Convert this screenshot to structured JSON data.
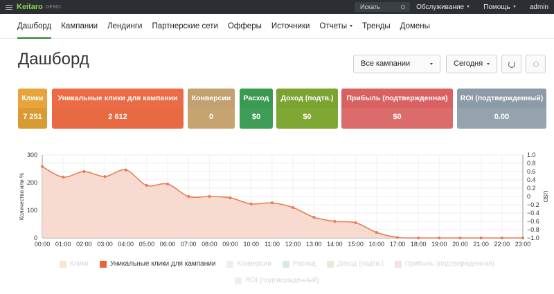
{
  "topbar": {
    "brand": "Keitaro",
    "demo": "DEMO",
    "search_label": "Искать",
    "service_menu": "Обслуживание",
    "help_menu": "Помощь",
    "user": "admin"
  },
  "nav": {
    "items": [
      "Дашборд",
      "Кампании",
      "Лендинги",
      "Партнерские сети",
      "Офферы",
      "Источники",
      "Отчеты",
      "Тренды",
      "Домены"
    ]
  },
  "page": {
    "title": "Дашборд",
    "campaign_select": "Все кампании",
    "period_select": "Сегодня"
  },
  "cards": [
    {
      "label": "Клики",
      "value": "7 251",
      "color": "#e8a33a",
      "value_color": "#d99a33"
    },
    {
      "label": "Уникальные клики для кампании",
      "value": "2 612",
      "color": "#ea6b45",
      "value_color": "#e86a43"
    },
    {
      "label": "Конверсии",
      "value": "0",
      "color": "#c2a070",
      "value_color": "#c6a472"
    },
    {
      "label": "Расход",
      "value": "$0",
      "color": "#3a9a52",
      "value_color": "#3e9d56"
    },
    {
      "label": "Доход (подтв.)",
      "value": "$0",
      "color": "#7aa32f",
      "value_color": "#7fa733"
    },
    {
      "label": "Прибыль (подтвержденная)",
      "value": "$0",
      "color": "#d96161",
      "value_color": "#dc6b6b"
    },
    {
      "label": "ROI (подтвержденный)",
      "value": "0.00",
      "color": "#8d9aa7",
      "value_color": "#96a2ae"
    }
  ],
  "chart_data": {
    "type": "area",
    "x": [
      "00:00",
      "01:00",
      "02:00",
      "03:00",
      "04:00",
      "05:00",
      "06:00",
      "07:00",
      "08:00",
      "09:00",
      "10:00",
      "11:00",
      "12:00",
      "13:00",
      "14:00",
      "15:00",
      "16:00",
      "17:00",
      "18:00",
      "19:00",
      "20:00",
      "21:00",
      "22:00",
      "23:00"
    ],
    "series": [
      {
        "name": "Уникальные клики для кампании",
        "values": [
          258,
          220,
          240,
          222,
          246,
          190,
          195,
          150,
          150,
          145,
          123,
          127,
          110,
          75,
          60,
          55,
          20,
          2,
          0,
          0,
          0,
          0,
          0,
          0
        ],
        "color": "#e8794f"
      }
    ],
    "ylabel": "Количество или %",
    "ylim": [
      0,
      300
    ],
    "yticks": [
      "0",
      "100",
      "200",
      "300"
    ],
    "y2label": "USD",
    "y2lim": [
      -1.0,
      1.0
    ],
    "y2ticks": [
      "1.0",
      "0.8",
      "0.6",
      "0.4",
      "0.2",
      "0",
      "−0.2",
      "−0.4",
      "−0.6",
      "−0.8",
      "−1.0"
    ],
    "grid": true,
    "legend_position": "bottom"
  },
  "legend": [
    {
      "name": "Клики",
      "color": "#f7e6cf",
      "active": false
    },
    {
      "name": "Уникальные клики для кампании",
      "color": "#e8643c",
      "active": true
    },
    {
      "name": "Конверсии",
      "color": "#eeeeee",
      "active": false
    },
    {
      "name": "Расход",
      "color": "#d4ece0",
      "active": false
    },
    {
      "name": "Доход (подтв.)",
      "color": "#e4ecd8",
      "active": false
    },
    {
      "name": "Прибыль (подтвержденная)",
      "color": "#f8e0e0",
      "active": false
    },
    {
      "name": "ROI (подтвержденный)",
      "color": "#eeeeee",
      "active": false
    }
  ]
}
